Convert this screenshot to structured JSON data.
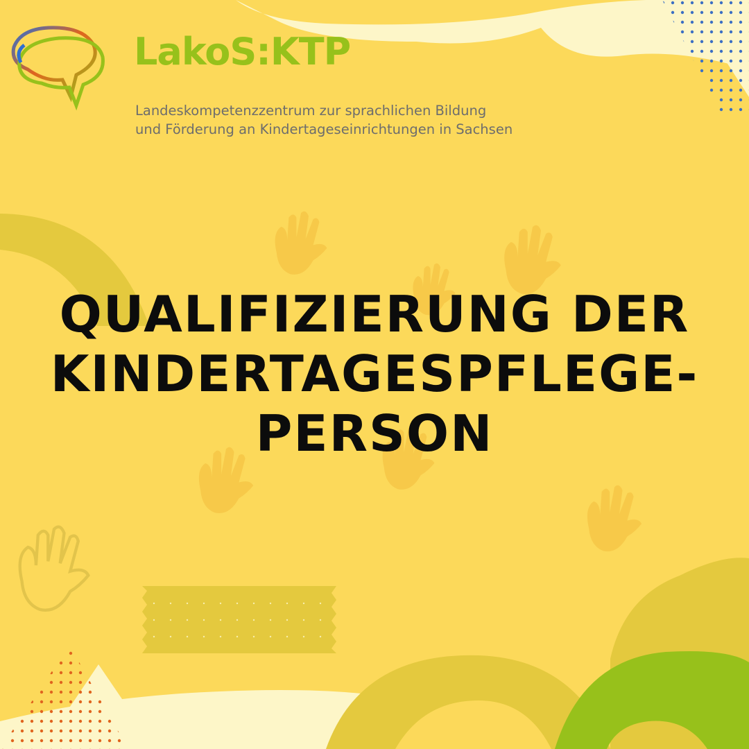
{
  "brand": {
    "name": "LakoS:KTP",
    "tagline_line1": "Landeskompetenzzentrum zur sprachlichen Bildung",
    "tagline_line2": "und Förderung an Kindertageseinrichtungen in Sachsen"
  },
  "headline": {
    "line1": "QUALIFIZIERUNG DER",
    "line2": "KINDERTAGESPFLEGE-",
    "line3": "PERSON"
  },
  "icons": [
    "speech-bubbles-logo-icon",
    "handprint-icon",
    "washi-tape",
    "dot-pattern",
    "triangle-shape"
  ],
  "colors": {
    "background": "#fcd95a",
    "shape_dark": "#e4c93e",
    "shape_light": "#fdf6c8",
    "brand_green": "#97c11b",
    "text_gray": "#6d6d6d",
    "headline": "#0c0c0c",
    "dots_blue": "#3b6fc4",
    "dots_orange": "#e0641e",
    "handprint": "#f2bc3c"
  }
}
